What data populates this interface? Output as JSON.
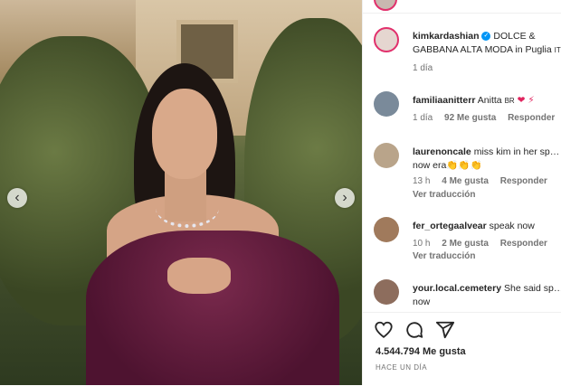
{
  "post": {
    "username": "kimkardashian",
    "caption": "DOLCE & GABBANA ALTA MODA in Puglia",
    "caption_flag": "IT",
    "time": "1 día"
  },
  "comments": [
    {
      "username": "familiaanitterr",
      "text": "Anitta",
      "flag": "BR",
      "emoji": "❤ ⚡",
      "time": "1 día",
      "likes": "92 Me gusta",
      "reply": "Responder",
      "translate": ""
    },
    {
      "username": "laurenoncale",
      "text": "miss kim in her sp… now era👏👏👏",
      "time": "13 h",
      "likes": "4 Me gusta",
      "reply": "Responder",
      "translate": "Ver traducción"
    },
    {
      "username": "fer_ortegaalvear",
      "text": "speak now",
      "time": "10 h",
      "likes": "2 Me gusta",
      "reply": "Responder",
      "translate": "Ver traducción"
    },
    {
      "username": "your.local.cemetery",
      "text": "She said sp… now",
      "time": "",
      "likes": "",
      "reply": "",
      "translate": ""
    }
  ],
  "footer": {
    "likes": "4.544.794 Me gusta",
    "ago": "HACE UN DÍA"
  },
  "icons": {
    "like": "heart-icon",
    "comment": "comment-icon",
    "share": "share-icon",
    "prev": "chevron-left-icon",
    "next": "chevron-right-icon"
  },
  "colors": {
    "accent": "#0095f6",
    "story_ring": "#e1306c",
    "muted": "#737373"
  }
}
